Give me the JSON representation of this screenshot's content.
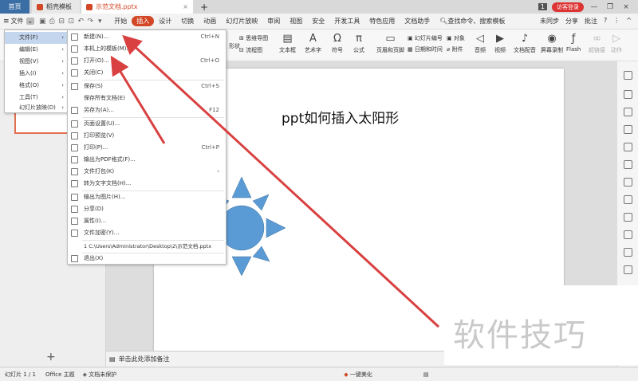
{
  "titlebar": {
    "home_tab": "首页",
    "templates_tab": "稻壳模板",
    "doc_tab": "示范文档.pptx",
    "close_tab": "×",
    "add_tab": "+",
    "badge": "1",
    "visitor_btn": "访客登录",
    "minimize": "—",
    "maximize": "❐",
    "close": "×"
  },
  "menubar": {
    "file": "文件",
    "items": [
      "开始",
      "插入",
      "设计",
      "切换",
      "动画",
      "幻灯片放映",
      "审阅",
      "视图",
      "安全",
      "开发工具",
      "特色应用",
      "文档助手"
    ],
    "active_item": "插入",
    "search": "查找命令、搜索模板",
    "sync": "未同步",
    "share": "分享",
    "comment": "批注",
    "help": "?",
    "more": "⋮",
    "collapse": "^"
  },
  "ribbon": {
    "smartart": "思维导图",
    "flowchart": "流程图",
    "textbox": "文本框",
    "art": "艺术字",
    "symbol": "符号",
    "formula": "公式",
    "header_footer": "页眉和页脚",
    "slide_number": "幻灯片编号",
    "datetime": "日期和时间",
    "object": "对象",
    "attachment": "附件",
    "audio": "音频",
    "video": "视频",
    "doc_audio": "文档配音",
    "screen_rec": "屏幕录制",
    "flash": "Flash",
    "hyperlink": "超链接",
    "action": "动作",
    "shapes_label": "形状"
  },
  "menu_level1": {
    "items": [
      {
        "label": "文件(F)",
        "arrow": "›"
      },
      {
        "label": "编辑(E)",
        "arrow": "›"
      },
      {
        "label": "视图(V)",
        "arrow": "›"
      },
      {
        "label": "插入(I)",
        "arrow": "›"
      },
      {
        "label": "格式(O)",
        "arrow": "›"
      },
      {
        "label": "工具(T)",
        "arrow": "›"
      },
      {
        "label": "幻灯片放映(D)",
        "arrow": "›"
      }
    ]
  },
  "menu_level2": {
    "items": [
      {
        "label": "新建(N)...",
        "shortcut": "Ctrl+N"
      },
      {
        "label": "本机上的模板(M)...",
        "shortcut": ""
      },
      {
        "label": "打开(O)...",
        "shortcut": "Ctrl+O"
      },
      {
        "label": "关闭(C)",
        "shortcut": ""
      },
      {
        "label": "保存(S)",
        "shortcut": "Ctrl+S"
      },
      {
        "label": "保存所有文档(E)",
        "shortcut": ""
      },
      {
        "label": "另存为(A)...",
        "shortcut": "F12"
      },
      {
        "label": "页面设置(U)...",
        "shortcut": ""
      },
      {
        "label": "打印预览(V)",
        "shortcut": ""
      },
      {
        "label": "打印(P)...",
        "shortcut": "Ctrl+P"
      },
      {
        "label": "输出为PDF格式(F)...",
        "shortcut": ""
      },
      {
        "label": "文件打包(K)",
        "shortcut": "›"
      },
      {
        "label": "转为文字文档(H)...",
        "shortcut": ""
      },
      {
        "label": "输出为图片(H)...",
        "shortcut": ""
      },
      {
        "label": "分享(D)",
        "shortcut": ""
      },
      {
        "label": "属性(I)...",
        "shortcut": ""
      },
      {
        "label": "文件加密(Y)...",
        "shortcut": ""
      },
      {
        "label": "1 C:\\Users\\Administrator\\Desktop\\2\\示范文档.pptx",
        "shortcut": ""
      },
      {
        "label": "退出(X)",
        "shortcut": ""
      }
    ]
  },
  "slide": {
    "title": "ppt如何插入太阳形"
  },
  "notes": {
    "placeholder": "单击此处添加备注"
  },
  "statusbar": {
    "slide_count": "幻灯片 1 / 1",
    "theme": "Office 主题",
    "protect": "文档未保护",
    "beautify": "一键美化",
    "zoom": "—"
  },
  "left_panel": {
    "add_slide": "+"
  },
  "watermark": "软件技巧",
  "colors": {
    "accent": "#d24726",
    "sun": "#5b9bd5",
    "arrow": "#d94040",
    "home_tab": "#3a6ea5",
    "selection": "#c4d6ee"
  }
}
